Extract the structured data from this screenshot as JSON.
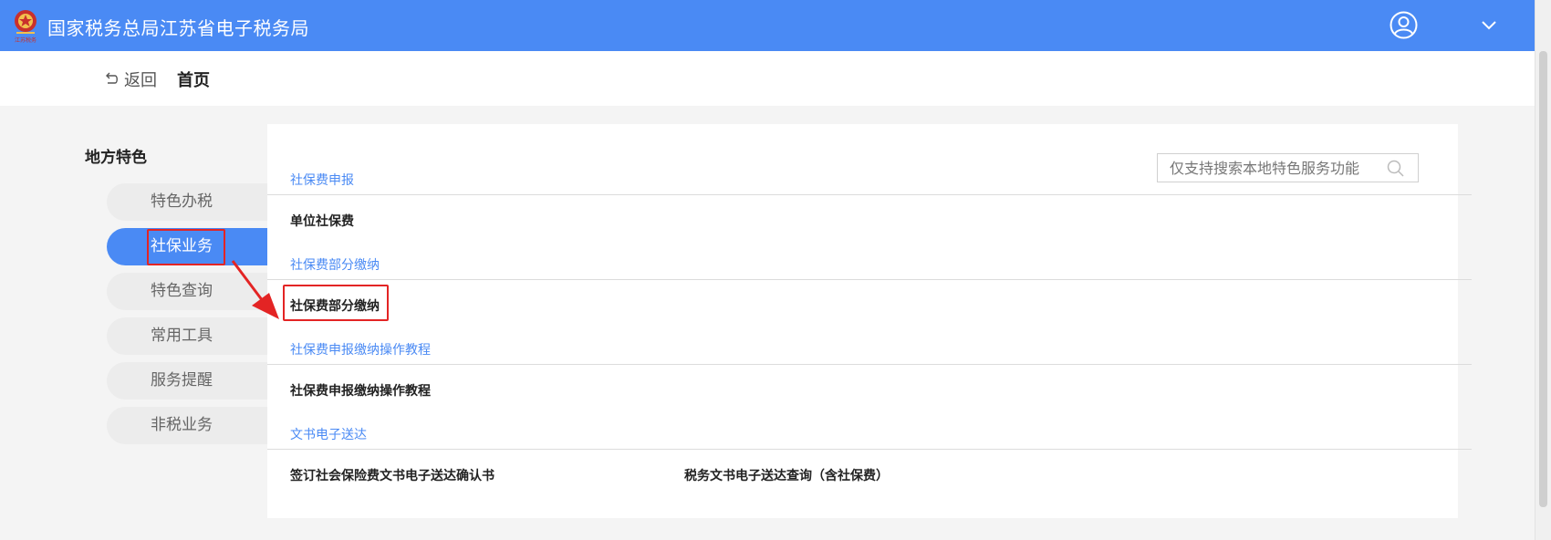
{
  "header": {
    "title": "国家税务总局江苏省电子税务局",
    "logo_icon": "tax-emblem-icon",
    "logo_caption": "江苏税务",
    "user_icon": "user-avatar-icon",
    "menu_icon": "chevron-down-icon",
    "accent_color": "#4a8af4"
  },
  "nav": {
    "back_label": "返回",
    "home_label": "首页"
  },
  "sidebar": {
    "title": "地方特色",
    "items": [
      {
        "label": "特色办税",
        "active": false
      },
      {
        "label": "社保业务",
        "active": true
      },
      {
        "label": "特色查询",
        "active": false
      },
      {
        "label": "常用工具",
        "active": false
      },
      {
        "label": "服务提醒",
        "active": false
      },
      {
        "label": "非税业务",
        "active": false
      }
    ]
  },
  "search": {
    "placeholder": "仅支持搜索本地特色服务功能"
  },
  "sections": [
    {
      "title": "社保费申报",
      "services": [
        "单位社保费"
      ]
    },
    {
      "title": "社保费部分缴纳",
      "services": [
        "社保费部分缴纳"
      ]
    },
    {
      "title": "社保费申报缴纳操作教程",
      "services": [
        "社保费申报缴纳操作教程"
      ]
    },
    {
      "title": "文书电子送达",
      "services": [
        "签订社会保险费文书电子送达确认书",
        "税务文书电子送达查询（含社保费）"
      ]
    }
  ]
}
